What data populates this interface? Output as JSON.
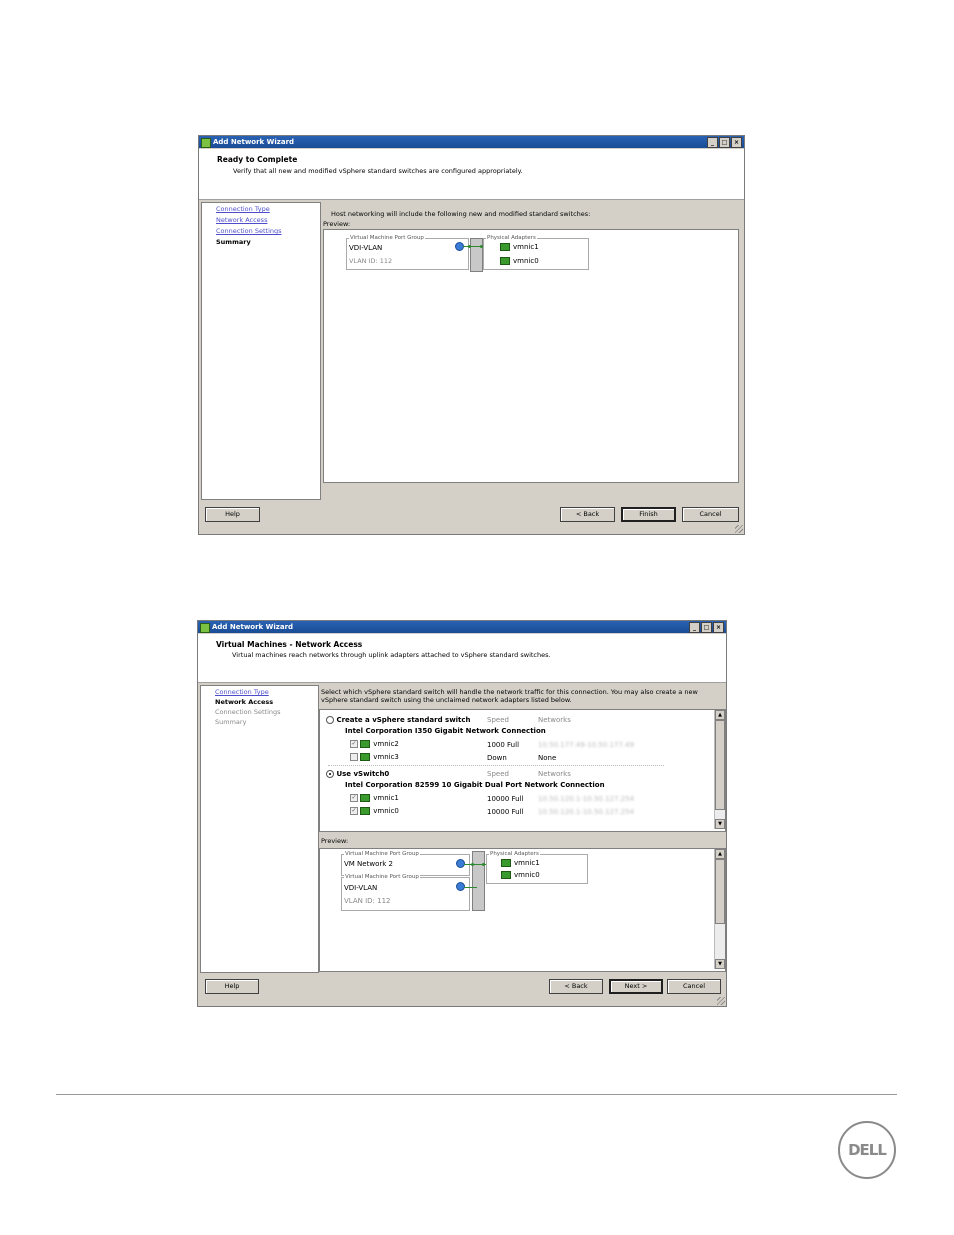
{
  "wizard1": {
    "title": "Add Network Wizard",
    "window_buttons": [
      "_",
      "□",
      "×"
    ],
    "header_title": "Ready to Complete",
    "header_subtitle": "Verify that all new and modified vSphere standard switches are configured appropriately.",
    "nav": [
      "Connection Type",
      "Network Access",
      "Connection Settings",
      "Summary"
    ],
    "info": "Host networking will include the following new and modified standard switches:",
    "preview_label": "Preview:",
    "vm_group_label": "Virtual Machine Port Group",
    "vm_name": "VDI-VLAN",
    "vlan": "VLAN ID: 112",
    "pa_label": "Physical Adapters",
    "adapters": [
      "vmnic1",
      "vmnic0"
    ],
    "buttons": {
      "help": "Help",
      "back": "< Back",
      "finish": "Finish",
      "cancel": "Cancel"
    }
  },
  "wizard2": {
    "title": "Add Network Wizard",
    "window_buttons": [
      "_",
      "□",
      "×"
    ],
    "header_title": "Virtual Machines - Network Access",
    "header_subtitle": "Virtual machines reach networks through uplink adapters attached to vSphere standard switches.",
    "nav": [
      "Connection Type",
      "Network Access",
      "Connection Settings",
      "Summary"
    ],
    "info": "Select which vSphere standard switch will handle the network traffic for this connection. You may also create a new vSphere standard switch using the unclaimed network adapters listed below.",
    "options": [
      {
        "label": "Create a vSphere standard switch",
        "speed_h": "Speed",
        "net_h": "Networks",
        "nic_title": "Intel Corporation I350 Gigabit Network Connection",
        "rows": [
          {
            "name": "vmnic2",
            "speed": "1000 Full",
            "net": "10.50.177.49-10.50.177.49"
          },
          {
            "name": "vmnic3",
            "speed": "Down",
            "net": "None"
          }
        ]
      },
      {
        "label": "Use vSwitch0",
        "speed_h": "Speed",
        "net_h": "Networks",
        "nic_title": "Intel Corporation 82599 10 Gigabit Dual Port Network Connection",
        "rows": [
          {
            "name": "vmnic1",
            "speed": "10000 Full",
            "net": "10.50.120.1-10.50.127.254"
          },
          {
            "name": "vmnic0",
            "speed": "10000 Full",
            "net": "10.50.120.1-10.50.127.254"
          }
        ]
      }
    ],
    "preview_label": "Preview:",
    "groups": [
      {
        "label": "Virtual Machine Port Group",
        "name": "VM Network 2"
      },
      {
        "label": "Virtual Machine Port Group",
        "name": "VDI-VLAN",
        "vlan": "VLAN ID: 112"
      }
    ],
    "pa_label": "Physical Adapters",
    "adapters": [
      "vmnic1",
      "vmnic0"
    ],
    "scroll_up": "▲",
    "scroll_down": "▼",
    "buttons": {
      "help": "Help",
      "back": "< Back",
      "next": "Next >",
      "cancel": "Cancel"
    }
  },
  "footer": {
    "logo": "DELL"
  }
}
